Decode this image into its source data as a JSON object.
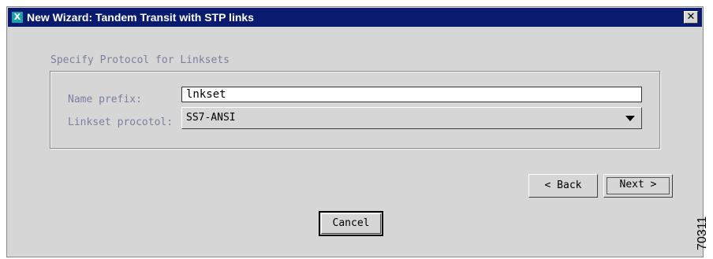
{
  "window": {
    "title": "New Wizard: Tandem Transit with STP links",
    "app_icon_glyph": "X",
    "close_glyph": "✕"
  },
  "section": {
    "title": "Specify Protocol for Linksets"
  },
  "form": {
    "name_prefix_label": "Name prefix:",
    "name_prefix_value": "lnkset",
    "protocol_label": "Linkset procotol:",
    "protocol_value": "SS7-ANSI"
  },
  "buttons": {
    "back": "< Back",
    "next": "Next >",
    "cancel": "Cancel"
  },
  "figure_id": "70311",
  "colors": {
    "titlebar": "#0a1a6e",
    "window_bg": "#d6d6d6",
    "label_text": "#7a7f9f"
  },
  "icons": {
    "app_icon": "x-window-icon",
    "close": "close-icon",
    "dropdown": "chevron-down-icon"
  }
}
